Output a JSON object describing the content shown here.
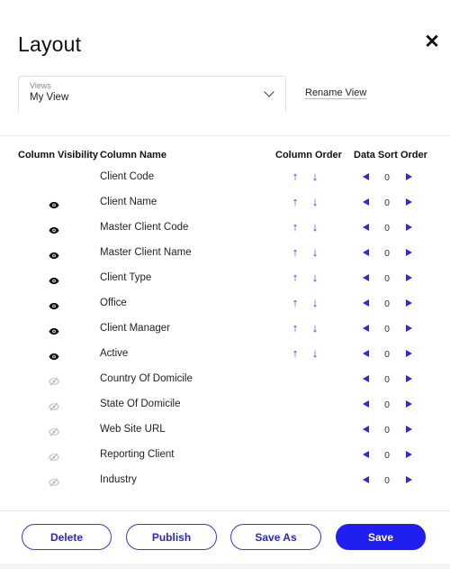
{
  "dialog": {
    "title": "Layout",
    "close_icon": "close-icon"
  },
  "views": {
    "label": "Views",
    "value": "My View",
    "rename_label": "Rename View"
  },
  "table": {
    "headers": {
      "visibility": "Column Visibility",
      "name": "Column Name",
      "order": "Column Order",
      "sort": "Data Sort Order"
    },
    "rows": [
      {
        "name": "Client Code",
        "visibility": "none",
        "orderable": true,
        "sort": "0"
      },
      {
        "name": "Client Name",
        "visibility": "visible",
        "orderable": true,
        "sort": "0"
      },
      {
        "name": "Master Client Code",
        "visibility": "visible",
        "orderable": true,
        "sort": "0"
      },
      {
        "name": "Master Client Name",
        "visibility": "visible",
        "orderable": true,
        "sort": "0"
      },
      {
        "name": "Client Type",
        "visibility": "visible",
        "orderable": true,
        "sort": "0"
      },
      {
        "name": "Office",
        "visibility": "visible",
        "orderable": true,
        "sort": "0"
      },
      {
        "name": "Client Manager",
        "visibility": "visible",
        "orderable": true,
        "sort": "0"
      },
      {
        "name": "Active",
        "visibility": "visible",
        "orderable": true,
        "sort": "0"
      },
      {
        "name": "Country Of Domicile",
        "visibility": "hidden",
        "orderable": false,
        "sort": "0"
      },
      {
        "name": "State Of Domicile",
        "visibility": "hidden",
        "orderable": false,
        "sort": "0"
      },
      {
        "name": "Web Site URL",
        "visibility": "hidden",
        "orderable": false,
        "sort": "0"
      },
      {
        "name": "Reporting Client",
        "visibility": "hidden",
        "orderable": false,
        "sort": "0"
      },
      {
        "name": "Industry",
        "visibility": "hidden",
        "orderable": false,
        "sort": "0"
      }
    ]
  },
  "footer": {
    "delete_label": "Delete",
    "publish_label": "Publish",
    "save_as_label": "Save As",
    "save_label": "Save"
  },
  "colors": {
    "accent": "#1f1ff0",
    "arrow": "#3333ee",
    "visible_eye": "#111111",
    "hidden_eye": "#b5b5b5"
  }
}
